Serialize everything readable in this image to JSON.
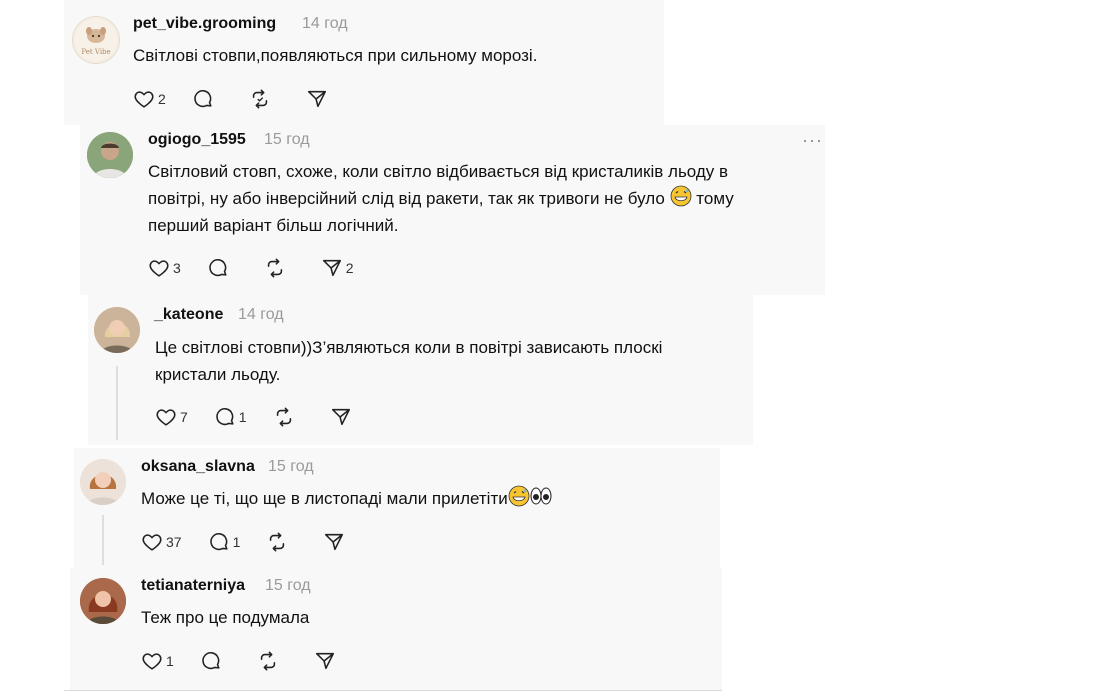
{
  "comments": [
    {
      "username": "pet_vibe.grooming",
      "time": "14 год",
      "avatar_text": "Pet Vibe",
      "lines": [
        "Світлові стовпи,появляються при сильному морозі."
      ],
      "likes": "2",
      "replies": "",
      "reposts": "",
      "shares": ""
    },
    {
      "username": "ogiogo_1595",
      "time": "15 год",
      "lines": [
        "Світловий стовп, схоже, коли світло відбивається від кристаликів льоду в",
        "повітрі, ну або інверсійний слід від ракети, так як тривоги не було",
        "тому",
        "перший варіант більш логічний."
      ],
      "more": "···",
      "likes": "3",
      "replies": "",
      "reposts": "",
      "shares": "2"
    },
    {
      "username": "_kateone",
      "time": "14 год",
      "lines": [
        "Це світлові стовпи))З’являються коли в повітрі зависають плоскі",
        "кристали льоду."
      ],
      "likes": "7",
      "replies": "1",
      "reposts": "",
      "shares": ""
    },
    {
      "username": "oksana_slavna",
      "time": "15 год",
      "lines": [
        "Може це ті, що ще в листопаді мали прилетіти"
      ],
      "likes": "37",
      "replies": "1",
      "reposts": "",
      "shares": ""
    },
    {
      "username": "tetianaterniya",
      "time": "15 год",
      "lines": [
        "Теж про це подумала"
      ],
      "likes": "1",
      "replies": "",
      "reposts": "",
      "shares": ""
    }
  ],
  "icons": {
    "like": "heart-icon",
    "reply": "comment-icon",
    "repost": "repost-icon",
    "share": "send-icon"
  }
}
